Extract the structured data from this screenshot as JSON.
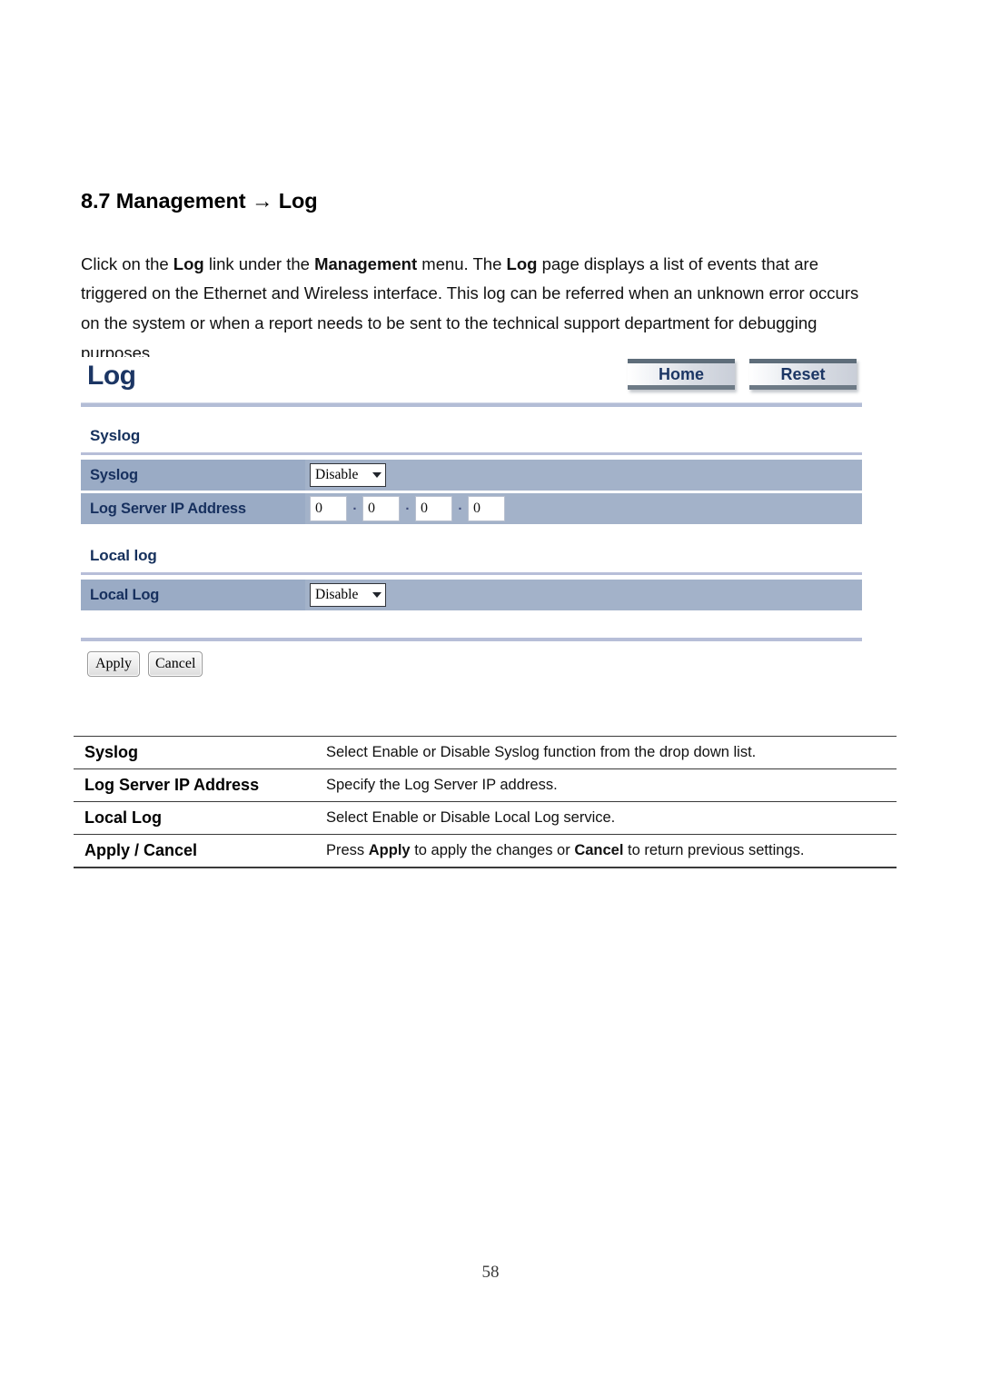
{
  "document": {
    "heading": "8.7 Management → Log",
    "paragraph_parts": [
      {
        "t": "Click on the ",
        "b": false
      },
      {
        "t": "Log",
        "b": true
      },
      {
        "t": " link under the ",
        "b": false
      },
      {
        "t": "Management",
        "b": true
      },
      {
        "t": " menu. The ",
        "b": false
      },
      {
        "t": "Log",
        "b": true
      },
      {
        "t": " page displays a list of events that are triggered on the Ethernet and Wireless interface. This log can be referred when an unknown error occurs on the system or when a report needs to be sent to the technical support department for debugging purposes.",
        "b": false
      }
    ],
    "page_number": "58"
  },
  "screenshot": {
    "title": "Log",
    "header_buttons": [
      {
        "label": "Home",
        "name": "home-button"
      },
      {
        "label": "Reset",
        "name": "reset-button"
      }
    ],
    "sections": [
      {
        "label": "Syslog",
        "rows": [
          {
            "label": "Syslog",
            "control": "select",
            "value": "Disable"
          },
          {
            "label": "Log Server IP Address",
            "control": "ip",
            "octets": [
              "0",
              "0",
              "0",
              "0"
            ],
            "separator": "."
          }
        ]
      },
      {
        "label": "Local log",
        "rows": [
          {
            "label": "Local Log",
            "control": "select",
            "value": "Disable"
          }
        ]
      }
    ],
    "actions": [
      {
        "label": "Apply",
        "name": "apply-button"
      },
      {
        "label": "Cancel",
        "name": "cancel-button"
      }
    ]
  },
  "description_table": {
    "rows": [
      {
        "term": "Syslog",
        "desc_parts": [
          {
            "t": "Select Enable or Disable Syslog function from the drop down list.",
            "b": false
          }
        ]
      },
      {
        "term": "Log Server IP Address",
        "desc_parts": [
          {
            "t": "Specify the Log Server IP address.",
            "b": false
          }
        ]
      },
      {
        "term": "Local Log",
        "desc_parts": [
          {
            "t": "Select Enable or Disable Local Log service.",
            "b": false
          }
        ]
      },
      {
        "term": "Apply / Cancel",
        "desc_parts": [
          {
            "t": "Press ",
            "b": false
          },
          {
            "t": "Apply",
            "b": true
          },
          {
            "t": " to apply the changes or ",
            "b": false
          },
          {
            "t": "Cancel",
            "b": true
          },
          {
            "t": " to return previous settings.",
            "b": false
          }
        ]
      }
    ]
  },
  "colors": {
    "label_cell": "#9aabc5",
    "value_cell": "#a3b2c9",
    "rule": "#b7bed8",
    "heading_blue": "#17305e"
  }
}
